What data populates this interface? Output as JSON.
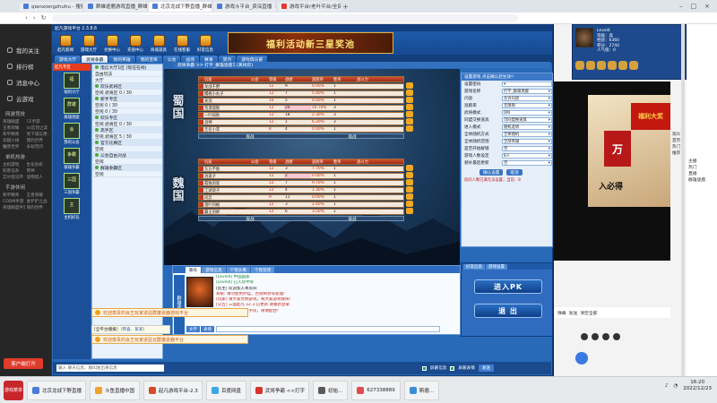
{
  "browser": {
    "tabs": [
      {
        "label": "qianxiongzhuhu - 搜索结果",
        "active": false
      },
      {
        "label": "群雄逐鹿游戏直播_群雄逐鹿直播间",
        "active": false
      },
      {
        "label": "北京龙战下野直播_群雄逐鹿",
        "active": true
      },
      {
        "label": "游戏斗平台_资深直播",
        "active": false
      },
      {
        "label": "游戏平台(老叶平台/全民游戏)",
        "active": false
      }
    ],
    "logo_label": "云游平台"
  },
  "sidebar": {
    "items": [
      "我的关注",
      "排行榜",
      "消息中心",
      "云游戏"
    ],
    "section_title": "网游竞技",
    "games": [
      "英雄联盟",
      "CF手游",
      "王者荣耀",
      "lol云顶之弈",
      "和平精英",
      "地下城与勇士",
      "穿越火线",
      "我的世界",
      "魔兽世界",
      "永劫无间"
    ],
    "section2_title": "单机热游",
    "games2": [
      "主机游戏",
      "生化危机",
      "刺客信条",
      "原神",
      "艾尔登法环",
      "怪物猎人"
    ],
    "section3_title": "手游休闲",
    "games3": [
      "和平精英",
      "王者荣耀",
      "CODM手游",
      "金铲铲之战",
      "英雄联盟手游",
      "我的世界"
    ],
    "bottom_button": "客户端打开"
  },
  "game": {
    "window_title": "起凡游戏平台 2.3.8.6",
    "toolbar": [
      "起凡新闻",
      "游戏大厅",
      "兑换中心",
      "充值中心",
      "商城道具",
      "在线客服",
      "好友信息"
    ],
    "banner_text": "福利活动新三星奖池",
    "tabs": [
      {
        "label": "游戏大厅",
        "active": false
      },
      {
        "label": "武将争霸",
        "active": true
      },
      {
        "label": "我的英雄",
        "active": false
      },
      {
        "label": "我的宝库",
        "active": false
      },
      {
        "label": "公会",
        "active": false
      },
      {
        "label": "战场",
        "active": false
      },
      {
        "label": "赛事",
        "active": false
      },
      {
        "label": "赏月",
        "active": false
      },
      {
        "label": "游戏俱乐部",
        "active": false
      }
    ],
    "left_column": {
      "header": "起凡专区",
      "items": [
        "福利大厅",
        "群雄逐鹿",
        "我的公会",
        "群雄争霸",
        "三国争霸",
        "主机好玩"
      ]
    },
    "room_list": [
      {
        "label": "电信大厅1区 (现在在线)",
        "group": true
      },
      {
        "label": "自由玩法",
        "group": false
      },
      {
        "label": "大厅",
        "group": false
      },
      {
        "label": "欢乐武将区",
        "group": true
      },
      {
        "label": "空闲    武将区    0 / 30",
        "group": false
      },
      {
        "label": "新手专区",
        "group": true
      },
      {
        "label": "空闲    0 / 30",
        "group": false
      },
      {
        "label": "空闲    0 / 30",
        "group": false
      },
      {
        "label": "欢乐专区",
        "group": true
      },
      {
        "label": "空闲    武将区    0 / 30",
        "group": false
      },
      {
        "label": "高手区",
        "group": true
      },
      {
        "label": "空闲    武将区    5 / 30",
        "group": false
      },
      {
        "label": "官方比赛区",
        "group": true
      },
      {
        "label": "空闲",
        "group": false
      },
      {
        "label": "公会自由对战",
        "group": true
      },
      {
        "label": "空闲",
        "group": false
      },
      {
        "label": "群雄争霸区",
        "group": true
      },
      {
        "label": "空闲",
        "group": false
      }
    ],
    "breadcrumb": "武将争霸 >> 打字_群雄逐鹿1 (离线房)",
    "kingdom_top": [
      "蜀",
      "国"
    ],
    "kingdom_bottom": [
      "魏",
      "国"
    ],
    "table_headers": [
      "",
      "玩家",
      "公会",
      "等级",
      "战绩",
      "逃跑率",
      "胜率",
      "战斗力"
    ],
    "team_top": [
      {
        "name": "龙战于野",
        "guild": "",
        "lvl": "12",
        "score": "9",
        "flee": "0.00%",
        "win": "1",
        "power": "",
        "pink": false
      },
      {
        "name": "樱桃小丸子",
        "guild": "",
        "lvl": "12",
        "score": "7",
        "flee": "5.40%",
        "win": "1",
        "power": "",
        "pink": false
      },
      {
        "name": "关羽",
        "guild": "",
        "lvl": "10",
        "score": "5",
        "flee": "0.00%",
        "win": "1",
        "power": "",
        "pink": false
      },
      {
        "name": "荒漠孤狼",
        "guild": "",
        "lvl": "12",
        "score": "20",
        "flee": "10.70%",
        "win": "3",
        "power": "",
        "pink": true
      },
      {
        "name": "一叶知秋",
        "guild": "",
        "lvl": "12",
        "score": "18",
        "flee": "2.30%",
        "win": "3",
        "power": "",
        "pink": false
      },
      {
        "name": "战神",
        "guild": "",
        "lvl": "12",
        "score": "1",
        "flee": "6.20%",
        "win": "3",
        "power": "",
        "pink": false
      },
      {
        "name": "无名小卒",
        "guild": "",
        "lvl": "8",
        "score": "4",
        "flee": "0.00%",
        "win": "1",
        "power": "",
        "pink": false
      }
    ],
    "team_top_footer": [
      "观战",
      "观战"
    ],
    "team_bottom": [
      {
        "name": "东方不败",
        "guild": "",
        "lvl": "12",
        "score": "3",
        "flee": "7.70%",
        "win": "1",
        "power": "",
        "pink": false
      },
      {
        "name": "逍遥子",
        "guild": "",
        "lvl": "12",
        "score": "2",
        "flee": "0.00%",
        "win": "1",
        "power": "",
        "pink": true
      },
      {
        "name": "孤独剑客",
        "guild": "",
        "lvl": "12",
        "score": "7",
        "flee": "9.70%",
        "win": "1",
        "power": "",
        "pink": false
      },
      {
        "name": "江湖浪子",
        "guild": "",
        "lvl": "12",
        "score": "4",
        "flee": "1.30%",
        "win": "1",
        "power": "",
        "pink": false
      },
      {
        "name": "风云",
        "guild": "",
        "lvl": "9",
        "score": "11",
        "flee": "0.00%",
        "win": "1",
        "power": "",
        "pink": false
      },
      {
        "name": "落叶归根",
        "guild": "",
        "lvl": "12",
        "score": "3",
        "flee": "2.40%",
        "win": "1",
        "power": "",
        "pink": false
      },
      {
        "name": "霸王别姬",
        "guild": "",
        "lvl": "12",
        "score": "6",
        "flee": "3.50%",
        "win": "1",
        "power": "",
        "pink": false
      }
    ],
    "team_bottom_footer": [
      "观战",
      "观战"
    ],
    "settings": {
      "header": "设置游戏  点击确认后生效!!",
      "rows": [
        {
          "label": "设置密码",
          "value": ""
        },
        {
          "label": "游戏名称",
          "value": "打字_群雄逐鹿"
        },
        {
          "label": "闪退",
          "value": "允许闪退"
        },
        {
          "label": "逃跑率",
          "value": "无限制"
        },
        {
          "label": "武将模式",
          "value": "DKI"
        },
        {
          "label": "同盟交换道具",
          "value": "可同盟换道具"
        },
        {
          "label": "进入模式",
          "value": "随机选将"
        },
        {
          "label": "全体随机方式",
          "value": "全体随机"
        },
        {
          "label": "全体随机范围",
          "value": "全部英雄"
        },
        {
          "label": "是否开始解锁",
          "value": "否"
        },
        {
          "label": "游戏人数设定",
          "value": "8人"
        },
        {
          "label": "替补最后更新",
          "value": "否"
        }
      ],
      "buttons": [
        "确认设置",
        "取消"
      ],
      "note": "房间人数已满无法设置，当前：8"
    },
    "chat": {
      "vertical_label": "群雄逐鹿",
      "tabs": [
        {
          "label": "聊天",
          "active": true
        },
        {
          "label": "游戏信息",
          "active": false
        },
        {
          "label": "个性头像",
          "active": false
        },
        {
          "label": "个性装饰",
          "active": false
        }
      ],
      "lines": [
        {
          "text": "[Level4] 中国国家",
          "class": "u"
        },
        {
          "text": "[Level4] 已入房中等",
          "class": "u"
        },
        {
          "text": "[房主] 欢迎加入本房间",
          "class": ""
        },
        {
          "text": "系统: 请勿使用外挂，否则将封号处理!",
          "class": "r"
        },
        {
          "text": "[玩家] 请大家文明游戏，祝大家游戏愉快!",
          "class": "r"
        },
        {
          "text": "[公告] 三国起凡 v2.3 已更新 请重新登录",
          "class": "r"
        },
        {
          "text": "[系统] 本房间为打字房，谢谢配合!",
          "class": "r"
        }
      ],
      "side_buttons": [
        "文字",
        "表情"
      ]
    },
    "pk": {
      "tabs": [
        "好友信息",
        "游戏设置"
      ],
      "enter_button": "进入PK",
      "exit_button": "退 出"
    },
    "notices": [
      "欢迎尊贵的会王玩家进驻群雄逐鹿游戏平台",
      "欢迎尊贵的会王玩家进驻云群雄逐鹿平台"
    ],
    "zhuanpan": [
      "[全平台播报]",
      "[恭喜、某某]"
    ],
    "status": {
      "input_placeholder": "输入 聊天信息、群叫发出来信息",
      "checkbox1": "屏蔽信息",
      "checkbox2": "屏蔽表情",
      "send": "发送"
    }
  },
  "right_panel": {
    "stats": [
      "Level4",
      "等级：高",
      "经验：6360",
      "积分：2740",
      "人气值：0"
    ],
    "ad_red": "福利大奖",
    "ad_logo": "万",
    "ad_text": "入必得",
    "bar_items": [
      "弹幕",
      "发送",
      "清空全部"
    ],
    "comment_labels": [
      "观众",
      "首页",
      "热门",
      "推荐"
    ],
    "edge_text": [
      "主播",
      "热门",
      "直播",
      "群雄逐鹿"
    ]
  },
  "taskbar": {
    "start_label": "游戏菜单",
    "tasks": [
      {
        "label": "游戏菜单",
        "color": "#c7272b"
      },
      {
        "label": "北京龙战下野直播",
        "color": "#4a7bd8"
      },
      {
        "label": "斗鱼直播中国",
        "color": "#f2a12f"
      },
      {
        "label": "起凡游戏平台-2.3",
        "color": "#d64a2a"
      },
      {
        "label": "百度网盘",
        "color": "#3aa8e6"
      },
      {
        "label": "武将争霸 <<打字",
        "color": "#d6342a"
      },
      {
        "label": "初始...",
        "color": "#5a5a5a"
      },
      {
        "label": "627338889",
        "color": "#e24b4b"
      },
      {
        "label": "斯德...",
        "color": "#3a8fd9"
      }
    ],
    "time": "16:20",
    "date": "2022/12/23"
  }
}
